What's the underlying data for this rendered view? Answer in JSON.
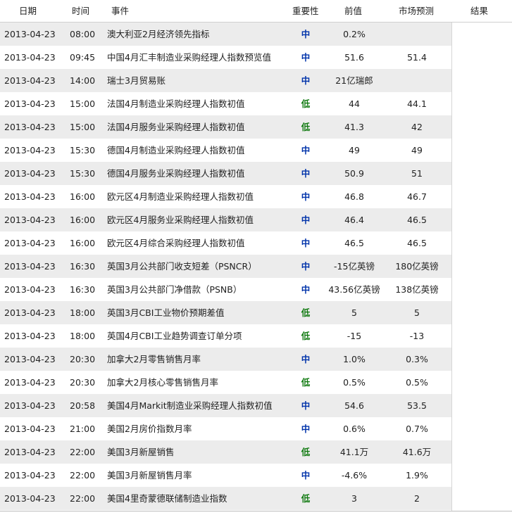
{
  "header": {
    "date": "日期",
    "time": "时间",
    "event": "事件",
    "importance": "重要性",
    "previous": "前值",
    "forecast": "市场预测",
    "result": "结果"
  },
  "colors": {
    "importance_mid": "#0033aa",
    "importance_low": "#117a11",
    "row_alt": "#ececec"
  },
  "rows": [
    {
      "date": "2013-04-23",
      "time": "08:00",
      "event": "澳大利亚2月经济领先指标",
      "importance": "中",
      "previous": "0.2%",
      "forecast": "",
      "result": ""
    },
    {
      "date": "2013-04-23",
      "time": "09:45",
      "event": "中国4月汇丰制造业采购经理人指数预览值",
      "importance": "中",
      "previous": "51.6",
      "forecast": "51.4",
      "result": ""
    },
    {
      "date": "2013-04-23",
      "time": "14:00",
      "event": "瑞士3月贸易账",
      "importance": "中",
      "previous": "21亿瑞郎",
      "forecast": "",
      "result": ""
    },
    {
      "date": "2013-04-23",
      "time": "15:00",
      "event": "法国4月制造业采购经理人指数初值",
      "importance": "低",
      "previous": "44",
      "forecast": "44.1",
      "result": ""
    },
    {
      "date": "2013-04-23",
      "time": "15:00",
      "event": "法国4月服务业采购经理人指数初值",
      "importance": "低",
      "previous": "41.3",
      "forecast": "42",
      "result": ""
    },
    {
      "date": "2013-04-23",
      "time": "15:30",
      "event": "德国4月制造业采购经理人指数初值",
      "importance": "中",
      "previous": "49",
      "forecast": "49",
      "result": ""
    },
    {
      "date": "2013-04-23",
      "time": "15:30",
      "event": "德国4月服务业采购经理人指数初值",
      "importance": "中",
      "previous": "50.9",
      "forecast": "51",
      "result": ""
    },
    {
      "date": "2013-04-23",
      "time": "16:00",
      "event": "欧元区4月制造业采购经理人指数初值",
      "importance": "中",
      "previous": "46.8",
      "forecast": "46.7",
      "result": ""
    },
    {
      "date": "2013-04-23",
      "time": "16:00",
      "event": "欧元区4月服务业采购经理人指数初值",
      "importance": "中",
      "previous": "46.4",
      "forecast": "46.5",
      "result": ""
    },
    {
      "date": "2013-04-23",
      "time": "16:00",
      "event": "欧元区4月综合采购经理人指数初值",
      "importance": "中",
      "previous": "46.5",
      "forecast": "46.5",
      "result": ""
    },
    {
      "date": "2013-04-23",
      "time": "16:30",
      "event": "英国3月公共部门收支短差（PSNCR）",
      "importance": "中",
      "previous": "-15亿英镑",
      "forecast": "180亿英镑",
      "result": ""
    },
    {
      "date": "2013-04-23",
      "time": "16:30",
      "event": "英国3月公共部门净借款（PSNB）",
      "importance": "中",
      "previous": "43.56亿英镑",
      "forecast": "138亿英镑",
      "result": ""
    },
    {
      "date": "2013-04-23",
      "time": "18:00",
      "event": "英国3月CBI工业物价预期差值",
      "importance": "低",
      "previous": "5",
      "forecast": "5",
      "result": ""
    },
    {
      "date": "2013-04-23",
      "time": "18:00",
      "event": "英国4月CBI工业趋势调查订单分项",
      "importance": "低",
      "previous": "-15",
      "forecast": "-13",
      "result": ""
    },
    {
      "date": "2013-04-23",
      "time": "20:30",
      "event": "加拿大2月零售销售月率",
      "importance": "中",
      "previous": "1.0%",
      "forecast": "0.3%",
      "result": ""
    },
    {
      "date": "2013-04-23",
      "time": "20:30",
      "event": "加拿大2月核心零售销售月率",
      "importance": "低",
      "previous": "0.5%",
      "forecast": "0.5%",
      "result": ""
    },
    {
      "date": "2013-04-23",
      "time": "20:58",
      "event": "美国4月Markit制造业采购经理人指数初值",
      "importance": "中",
      "previous": "54.6",
      "forecast": "53.5",
      "result": ""
    },
    {
      "date": "2013-04-23",
      "time": "21:00",
      "event": "美国2月房价指数月率",
      "importance": "中",
      "previous": "0.6%",
      "forecast": "0.7%",
      "result": ""
    },
    {
      "date": "2013-04-23",
      "time": "22:00",
      "event": "美国3月新屋销售",
      "importance": "低",
      "previous": "41.1万",
      "forecast": "41.6万",
      "result": ""
    },
    {
      "date": "2013-04-23",
      "time": "22:00",
      "event": "美国3月新屋销售月率",
      "importance": "中",
      "previous": "-4.6%",
      "forecast": "1.9%",
      "result": ""
    },
    {
      "date": "2013-04-23",
      "time": "22:00",
      "event": "美国4里奇蒙德联储制造业指数",
      "importance": "低",
      "previous": "3",
      "forecast": "2",
      "result": ""
    }
  ]
}
